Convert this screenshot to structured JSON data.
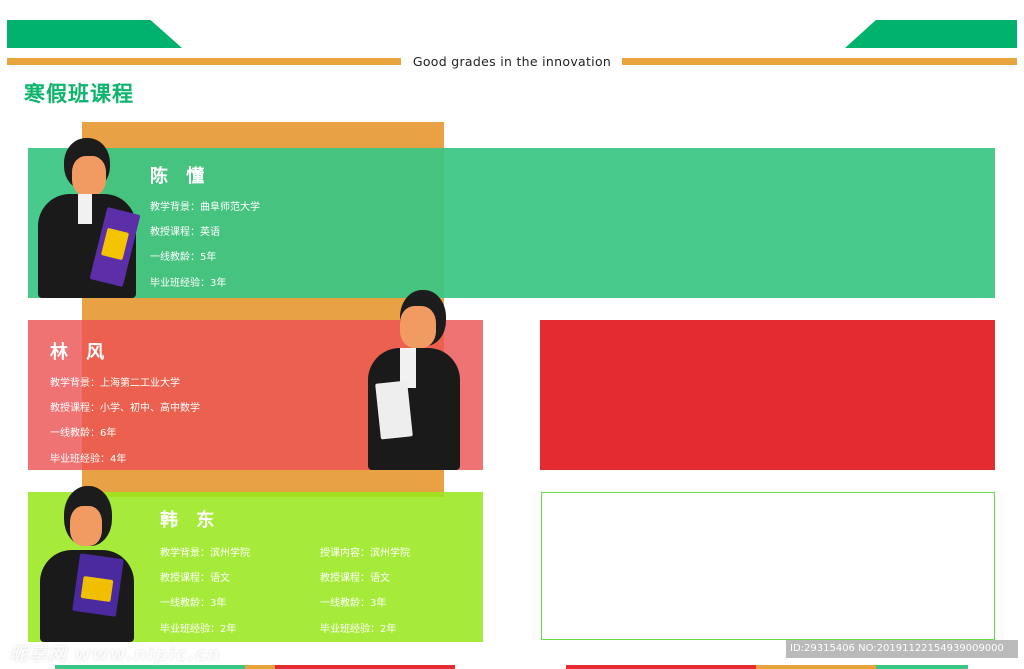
{
  "header": {
    "tagline": "Good grades in  the innovation",
    "title": "寒假班课程"
  },
  "colors": {
    "brand_green": "#00b26b",
    "accent_orange": "#e8a33c",
    "card1_green": "#3ac684",
    "card2_red": "#eb5050",
    "card3_lime": "#9ae81e",
    "panel_red": "#e52b32"
  },
  "teachers": [
    {
      "name": "陈 懂",
      "lines": [
        "教学背景：曲阜师范大学",
        "教授课程：英语",
        "一线教龄：5年",
        "毕业班经验：3年"
      ]
    },
    {
      "name": "林 风",
      "lines": [
        "教学背景：上海第二工业大学",
        "教授课程：小学、初中、高中数学",
        "一线教龄：6年",
        "毕业班经验：4年"
      ]
    },
    {
      "name": "韩 东",
      "lines": [
        "教学背景：滨州学院",
        "教授课程：语文",
        "一线教龄：3年",
        "毕业班经验：2年"
      ],
      "lines_right": [
        "授课内容：滨州学院",
        "教授课程：语文",
        "一线教龄：3年",
        "毕业班经验：2年"
      ]
    }
  ],
  "footer": {
    "watermark": "昵享网 www.nipic.cn",
    "image_id": "ID:29315406 NO:20191122154939009000"
  }
}
